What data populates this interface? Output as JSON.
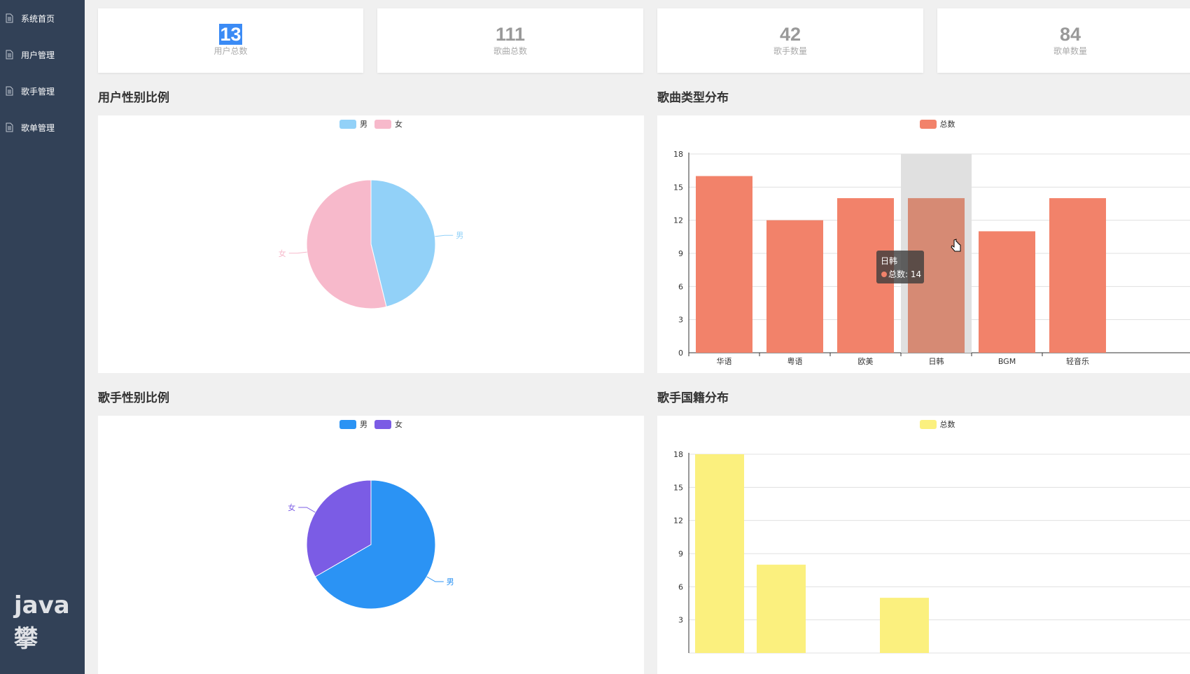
{
  "sidebar": {
    "items": [
      {
        "label": "系统首页",
        "icon": "document-icon"
      },
      {
        "label": "用户管理",
        "icon": "document-icon"
      },
      {
        "label": "歌手管理",
        "icon": "document-icon"
      },
      {
        "label": "歌单管理",
        "icon": "document-icon"
      }
    ]
  },
  "stats": [
    {
      "value": "13",
      "label": "用户总数"
    },
    {
      "value": "111",
      "label": "歌曲总数"
    },
    {
      "value": "42",
      "label": "歌手数量"
    },
    {
      "value": "84",
      "label": "歌单数量"
    }
  ],
  "sections": {
    "user_gender": "用户性别比例",
    "song_type": "歌曲类型分布",
    "singer_gender": "歌手性别比例",
    "singer_country": "歌手国籍分布"
  },
  "tooltip": {
    "title": "日韩",
    "text": "总数: 14"
  },
  "watermark": {
    "text": "java攀"
  },
  "chart_data": [
    {
      "type": "pie",
      "title": "用户性别比例",
      "legend": [
        "男",
        "女"
      ],
      "slices": [
        {
          "name": "男",
          "value": 6,
          "color": "#92d1f8"
        },
        {
          "name": "女",
          "value": 7,
          "color": "#f7b9cb"
        }
      ]
    },
    {
      "type": "bar",
      "title": "歌曲类型分布",
      "legend": [
        "总数"
      ],
      "color": "#f2826a",
      "categories": [
        "华语",
        "粤语",
        "欧美",
        "日韩",
        "BGM",
        "轻音乐"
      ],
      "values": [
        16,
        12,
        14,
        14,
        11,
        14
      ],
      "ylim": [
        0,
        18
      ],
      "yticks": [
        "0",
        "3",
        "6",
        "9",
        "12",
        "15",
        "18"
      ]
    },
    {
      "type": "pie",
      "title": "歌手性别比例",
      "legend": [
        "男",
        "女"
      ],
      "slices": [
        {
          "name": "男",
          "value": 28,
          "color": "#2b93f4"
        },
        {
          "name": "女",
          "value": 14,
          "color": "#7b5ce5"
        }
      ]
    },
    {
      "type": "bar",
      "title": "歌手国籍分布",
      "legend": [
        "总数"
      ],
      "color": "#fbf07e",
      "values": [
        18,
        8,
        null,
        5
      ],
      "ylim": [
        0,
        18
      ],
      "yticks": [
        "3",
        "6",
        "9",
        "12",
        "15",
        "18"
      ]
    }
  ]
}
